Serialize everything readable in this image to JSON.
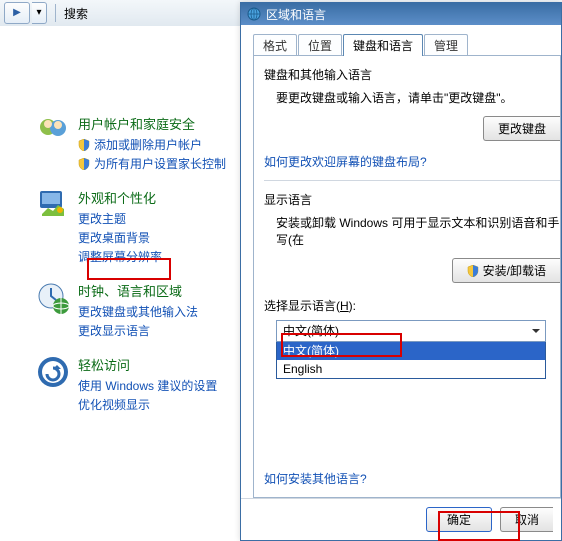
{
  "toolbar": {
    "search_label_fragment": "搜索"
  },
  "cp_categories": [
    {
      "id": "user",
      "title": "用户帐户和家庭安全",
      "links": [
        {
          "shield": true,
          "label": "添加或删除用户帐户"
        },
        {
          "shield": true,
          "label": "为所有用户设置家长控制"
        }
      ]
    },
    {
      "id": "appearance",
      "title": "外观和个性化",
      "links": [
        {
          "shield": false,
          "label": "更改主题"
        },
        {
          "shield": false,
          "label": "更改桌面背景"
        },
        {
          "shield": false,
          "label": "调整屏幕分辨率"
        }
      ]
    },
    {
      "id": "clock",
      "title": "时钟、语言和区域",
      "links": [
        {
          "shield": false,
          "label": "更改键盘或其他输入法"
        },
        {
          "shield": false,
          "label": "更改显示语言"
        }
      ]
    },
    {
      "id": "ease",
      "title": "轻松访问",
      "links": [
        {
          "shield": false,
          "label": "使用 Windows 建议的设置"
        },
        {
          "shield": false,
          "label": "优化视频显示"
        }
      ]
    }
  ],
  "dialog": {
    "title": "区域和语言",
    "tabs": [
      "格式",
      "位置",
      "键盘和语言",
      "管理"
    ],
    "active_tab": 2,
    "kb_section_label": "键盘和其他输入语言",
    "kb_note": "要更改键盘或输入语言，请单击\"更改键盘\"。",
    "kb_button": "更改键盘",
    "kb_link": "如何更改欢迎屏幕的键盘布局?",
    "lang_section_label": "显示语言",
    "lang_note": "安装或卸载 Windows 可用于显示文本和识别语音和手写(在",
    "lang_btn": "安装/卸载语",
    "choose_label_pre": "选择显示语言(",
    "choose_label_key": "H",
    "choose_label_post": "):",
    "dropdown_value": "中文(简体)",
    "dropdown_items": [
      "中文(简体)",
      "English"
    ],
    "install_other_link": "如何安装其他语言?",
    "ok": "确定",
    "cancel": "取消"
  }
}
